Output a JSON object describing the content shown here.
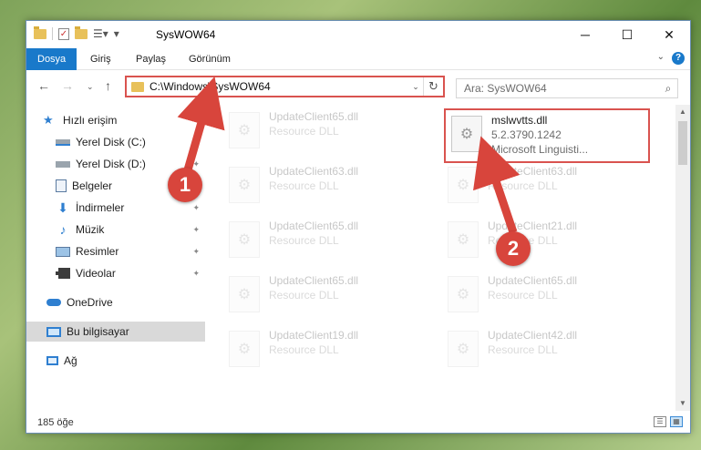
{
  "window": {
    "title": "SysWOW64"
  },
  "ribbon": {
    "tabs": [
      {
        "label": "Dosya",
        "active": true
      },
      {
        "label": "Giriş",
        "active": false
      },
      {
        "label": "Paylaş",
        "active": false
      },
      {
        "label": "Görünüm",
        "active": false
      }
    ],
    "help": "?"
  },
  "navbar": {
    "address": "C:\\Windows\\SysWOW64",
    "search_placeholder": "Ara: SysWOW64"
  },
  "sidebar": {
    "items": [
      {
        "label": "Hızlı erişim",
        "icon": "star-icon"
      },
      {
        "label": "Yerel Disk (C:)",
        "icon": "drive-icon"
      },
      {
        "label": "Yerel Disk (D:)",
        "icon": "drive-icon"
      },
      {
        "label": "Belgeler",
        "icon": "document-icon"
      },
      {
        "label": "İndirmeler",
        "icon": "download-icon"
      },
      {
        "label": "Müzik",
        "icon": "music-icon"
      },
      {
        "label": "Resimler",
        "icon": "pictures-icon"
      },
      {
        "label": "Videolar",
        "icon": "video-icon"
      },
      {
        "label": "OneDrive",
        "icon": "cloud-icon"
      },
      {
        "label": "Bu bilgisayar",
        "icon": "computer-icon"
      },
      {
        "label": "Ağ",
        "icon": "network-icon"
      }
    ]
  },
  "files": {
    "highlighted": {
      "name": "mslwvtts.dll",
      "version": "5.2.3790.1242",
      "company": "Microsoft Linguisti..."
    },
    "faded": [
      {
        "name": "UpdateClient65.dll",
        "sub": "Resource DLL"
      },
      {
        "name": "UpdateClient63.dll",
        "sub": "Resource DLL"
      },
      {
        "name": "UpdateClient63.dll",
        "sub": "Resource DLL"
      },
      {
        "name": "UpdateClient65.dll",
        "sub": "Resource DLL"
      },
      {
        "name": "UpdateClient21.dll",
        "sub": "Resource DLL"
      },
      {
        "name": "UpdateClient65.dll",
        "sub": "Resource DLL"
      },
      {
        "name": "UpdateClient65.dll",
        "sub": "Resource DLL"
      },
      {
        "name": "UpdateClient19.dll",
        "sub": "Resource DLL"
      },
      {
        "name": "UpdateClient42.dll",
        "sub": "Resource DLL"
      }
    ]
  },
  "status": {
    "count": "185 öğe"
  },
  "annotations": {
    "badge1": "1",
    "badge2": "2"
  },
  "colors": {
    "accent": "#1979ca",
    "highlight": "#d9534f",
    "badge": "#d8453c"
  }
}
